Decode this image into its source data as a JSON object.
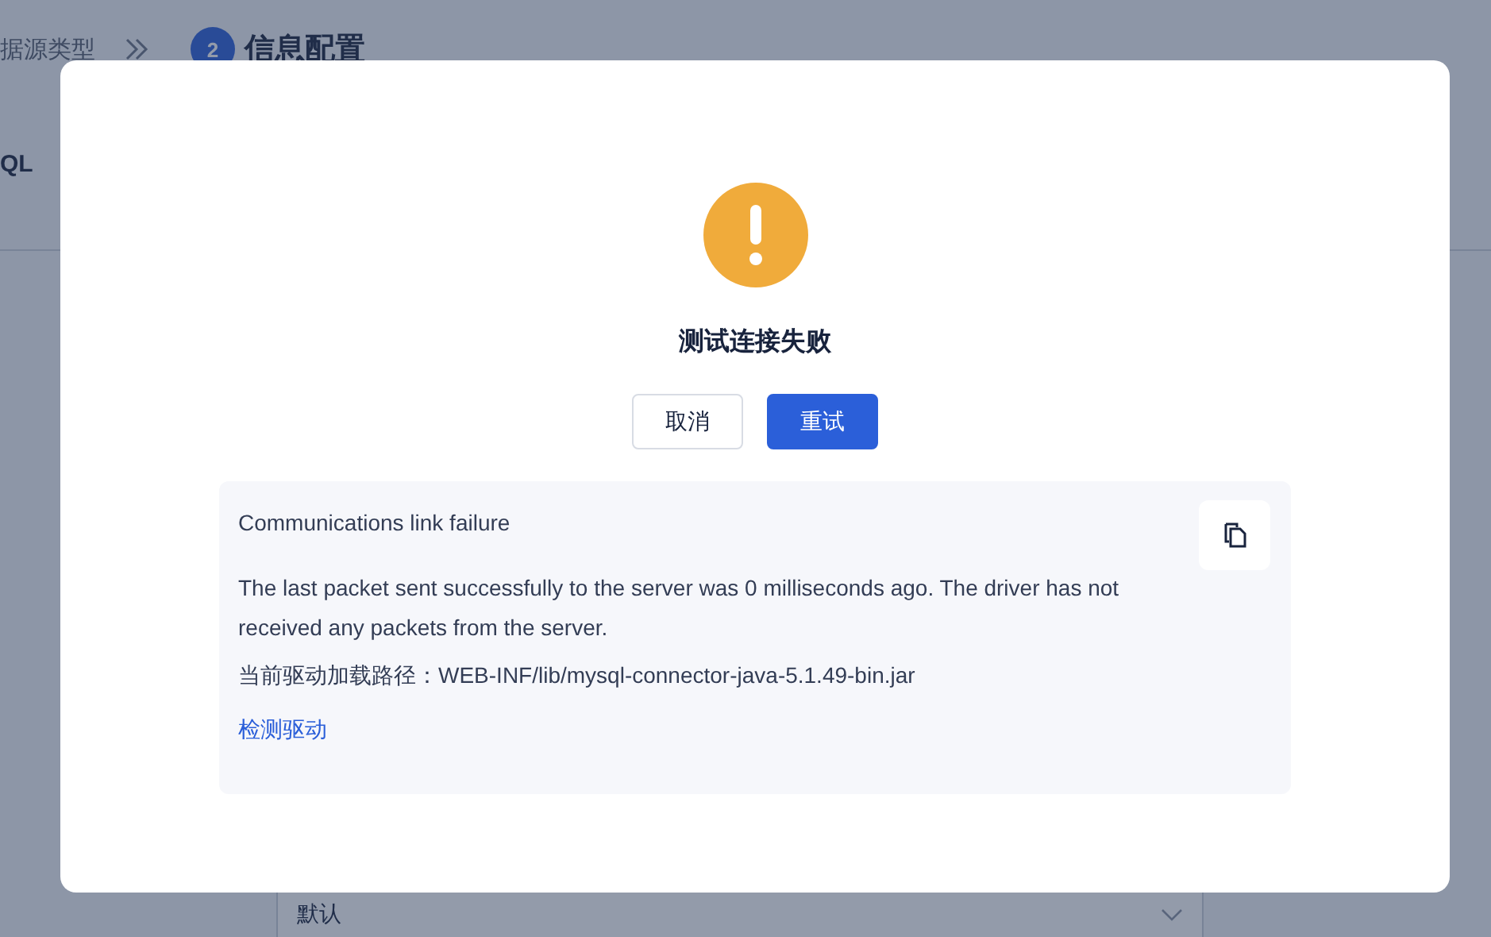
{
  "background_page": {
    "breadcrumb": {
      "previous_step": "据源类型",
      "step_number": "2",
      "current_step": "信息配置"
    },
    "side_label": "QL",
    "select": {
      "value": "默认"
    }
  },
  "dialog": {
    "title": "测试连接失败",
    "buttons": [
      {
        "label": "取消",
        "kind": "secondary"
      },
      {
        "label": "重试",
        "kind": "primary"
      }
    ],
    "details": {
      "lines": [
        "Communications link failure",
        "The last packet sent successfully to the server was 0 milliseconds ago. The driver has not received any packets from the server.",
        "当前驱动加载路径：WEB-INF/lib/mysql-connector-java-5.1.49-bin.jar"
      ],
      "link": "检测驱动"
    }
  }
}
